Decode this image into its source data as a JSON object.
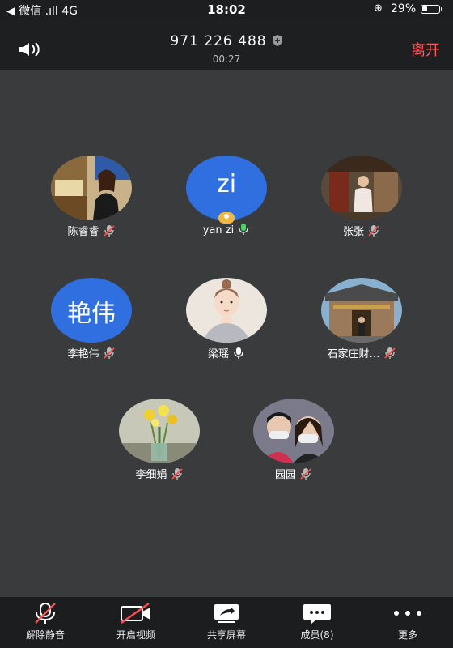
{
  "status": {
    "carrier": "◀ 微信 .ıll 4G",
    "time": "18:02",
    "alarm": "⊕",
    "battery": "29%"
  },
  "header": {
    "meeting_id": "971 226 488",
    "elapsed": "00:27",
    "leave_label": "离开"
  },
  "participants": [
    {
      "name": "陈睿睿",
      "mic": "muted",
      "avatar_text": ""
    },
    {
      "name": "yan zi",
      "mic": "on",
      "avatar_text": "zi",
      "host": true
    },
    {
      "name": "张张",
      "mic": "muted",
      "avatar_text": ""
    },
    {
      "name": "李艳伟",
      "mic": "muted",
      "avatar_text": "艳伟"
    },
    {
      "name": "梁瑶",
      "mic": "on",
      "avatar_text": ""
    },
    {
      "name": "石家庄财…",
      "mic": "muted",
      "avatar_text": ""
    },
    {
      "name": "李细娟",
      "mic": "muted",
      "avatar_text": ""
    },
    {
      "name": "园园",
      "mic": "muted",
      "avatar_text": ""
    }
  ],
  "toolbar": {
    "unmute": "解除静音",
    "start_video": "开启视频",
    "share_screen": "共享屏幕",
    "members": "成员(8)",
    "more": "更多"
  },
  "colors": {
    "background": "#3a3b3d",
    "header": "#1e1f21",
    "leave": "#ff5a5a",
    "avatar_blue": "#2f6fe0",
    "mic_active": "#4cd964",
    "host_badge": "#f1b840"
  }
}
